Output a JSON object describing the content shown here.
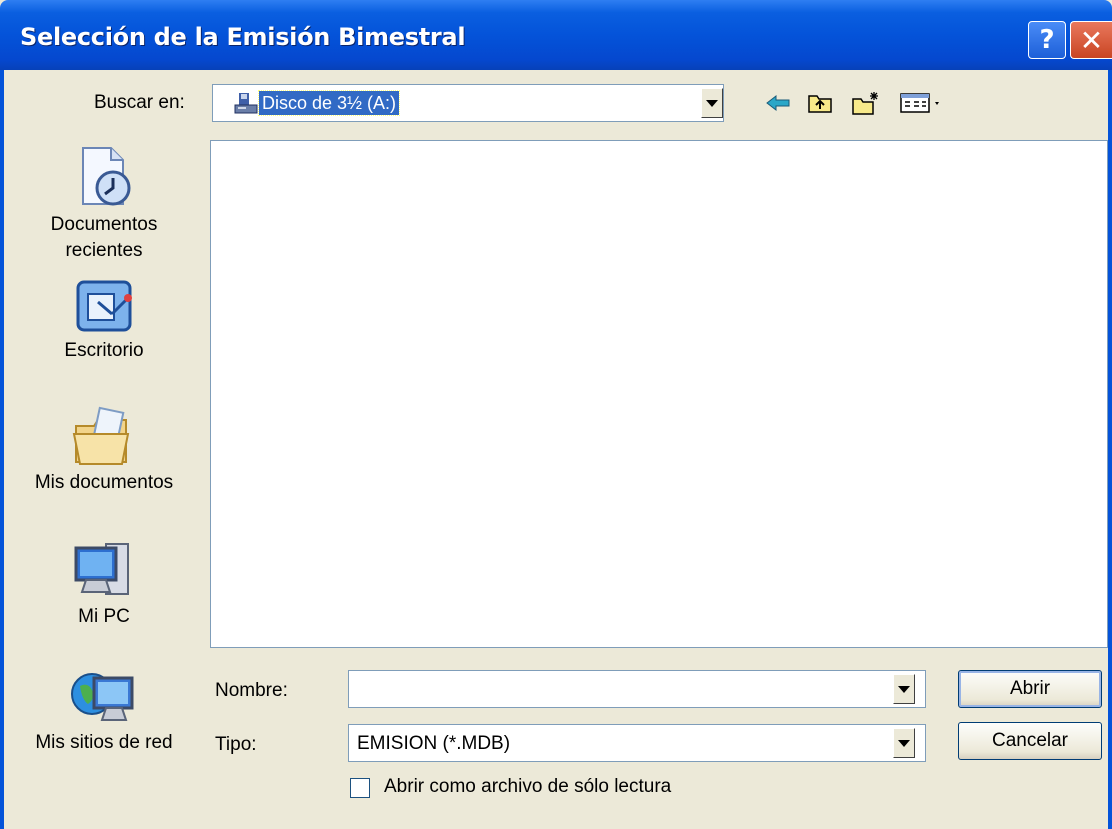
{
  "window": {
    "title": "Selección de la Emisión Bimestral",
    "help_label": "?",
    "close_label": "✕"
  },
  "lookin": {
    "label": "Buscar en:",
    "value": "Disco de 3½ (A:)",
    "icon": "floppy-drive-icon"
  },
  "toolbar": {
    "icons": [
      "back-arrow-icon",
      "up-folder-icon",
      "new-folder-icon",
      "view-menu-icon"
    ]
  },
  "places": [
    {
      "label": "Documentos\nrecientes",
      "icon": "recent-documents-icon"
    },
    {
      "label": "Escritorio",
      "icon": "desktop-icon"
    },
    {
      "label": "Mis documentos",
      "icon": "my-documents-icon"
    },
    {
      "label": "Mi PC",
      "icon": "my-computer-icon"
    },
    {
      "label": "Mis sitios de red",
      "icon": "network-places-icon"
    }
  ],
  "filelist": {
    "items": []
  },
  "filename": {
    "label": "Nombre:",
    "value": ""
  },
  "filetype": {
    "label": "Tipo:",
    "value": "EMISION (*.MDB)"
  },
  "readonly": {
    "label": "Abrir como archivo de sólo lectura",
    "checked": false
  },
  "buttons": {
    "open": "Abrir",
    "cancel": "Cancelar"
  }
}
